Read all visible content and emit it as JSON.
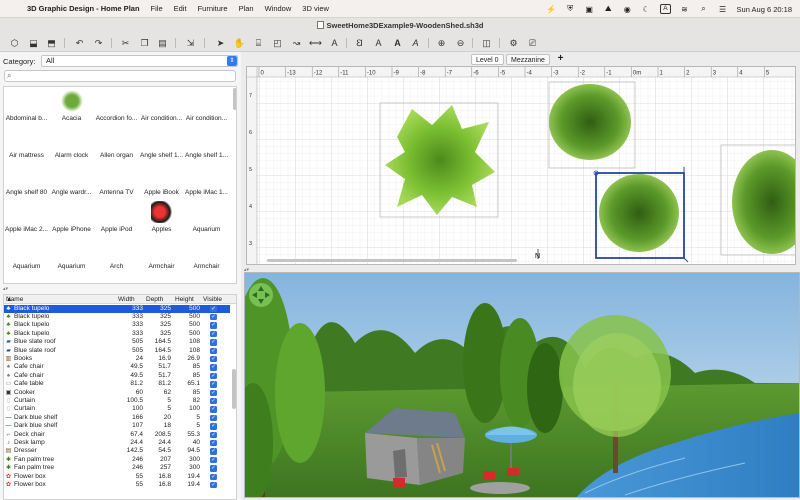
{
  "menubar": {
    "app_name": "3D Graphic Design - Home Plan",
    "menus": [
      "File",
      "Edit",
      "Furniture",
      "Plan",
      "Window",
      "3D view"
    ],
    "input_source": "A",
    "clock": "Sun Aug 6  20:18"
  },
  "window": {
    "title": "SweetHome3DExample9-WoodenShed.sh3d"
  },
  "category": {
    "label": "Category:",
    "selected": "All"
  },
  "search": {
    "placeholder": ""
  },
  "catalog": [
    {
      "label": "Abdominal b...",
      "icon": "abdominal-bench"
    },
    {
      "label": "Acacia",
      "icon": "acacia-tree"
    },
    {
      "label": "Accordion fo...",
      "icon": "accordion-door"
    },
    {
      "label": "Air condition...",
      "icon": "air-conditioner"
    },
    {
      "label": "Air condition...",
      "icon": "air-conditioner-wall"
    },
    {
      "label": "Air mattress",
      "icon": "air-mattress"
    },
    {
      "label": "Alarm clock",
      "icon": "alarm-clock"
    },
    {
      "label": "Allen organ",
      "icon": "organ"
    },
    {
      "label": "Angle shelf 1...",
      "icon": "angle-shelf"
    },
    {
      "label": "Angle shelf 1...",
      "icon": "angle-shelf"
    },
    {
      "label": "Angle shelf 80",
      "icon": "angle-shelf"
    },
    {
      "label": "Angle wardr...",
      "icon": "angle-wardrobe"
    },
    {
      "label": "Antenna TV",
      "icon": "antenna"
    },
    {
      "label": "Apple iBook",
      "icon": "laptop"
    },
    {
      "label": "Apple iMac 1...",
      "icon": "imac"
    },
    {
      "label": "Apple iMac 2...",
      "icon": "imac"
    },
    {
      "label": "Apple iPhone",
      "icon": "phone"
    },
    {
      "label": "Apple iPod",
      "icon": "ipod"
    },
    {
      "label": "Apples",
      "icon": "apples"
    },
    {
      "label": "Aquarium",
      "icon": "aquarium"
    },
    {
      "label": "Aquarium",
      "icon": "aquarium-stand"
    },
    {
      "label": "Aquarium",
      "icon": "aquarium-cabinet"
    },
    {
      "label": "Arch",
      "icon": "arch"
    },
    {
      "label": "Armchair",
      "icon": "armchair-red"
    },
    {
      "label": "Armchair",
      "icon": "armchair-black"
    }
  ],
  "furniture_table": {
    "headers": {
      "name": "Name",
      "width": "Width",
      "depth": "Depth",
      "height": "Height",
      "visible": "Visible"
    },
    "sort_indicator": "▲",
    "rows": [
      {
        "name": "Black tupelo",
        "width": "333",
        "depth": "325",
        "height": "500",
        "icon": "tree",
        "selected": true
      },
      {
        "name": "Black tupelo",
        "width": "333",
        "depth": "325",
        "height": "500",
        "icon": "tree"
      },
      {
        "name": "Black tupelo",
        "width": "333",
        "depth": "325",
        "height": "500",
        "icon": "tree"
      },
      {
        "name": "Black tupelo",
        "width": "333",
        "depth": "325",
        "height": "500",
        "icon": "tree"
      },
      {
        "name": "Blue slate roof",
        "width": "505",
        "depth": "164.5",
        "height": "108",
        "icon": "roof"
      },
      {
        "name": "Blue slate roof",
        "width": "505",
        "depth": "164.5",
        "height": "108",
        "icon": "roof"
      },
      {
        "name": "Books",
        "width": "24",
        "depth": "16.9",
        "height": "26.9",
        "icon": "books"
      },
      {
        "name": "Cafe chair",
        "width": "49.5",
        "depth": "51.7",
        "height": "85",
        "icon": "chair"
      },
      {
        "name": "Cafe chair",
        "width": "49.5",
        "depth": "51.7",
        "height": "85",
        "icon": "chair"
      },
      {
        "name": "Cafe table",
        "width": "81.2",
        "depth": "81.2",
        "height": "65.1",
        "icon": "table"
      },
      {
        "name": "Cooker",
        "width": "60",
        "depth": "62",
        "height": "85",
        "icon": "cooker"
      },
      {
        "name": "Curtain",
        "width": "100.5",
        "depth": "5",
        "height": "82",
        "icon": "curtain"
      },
      {
        "name": "Curtain",
        "width": "100",
        "depth": "5",
        "height": "100",
        "icon": "curtain"
      },
      {
        "name": "Dark blue shelf",
        "width": "166",
        "depth": "20",
        "height": "5",
        "icon": "shelf"
      },
      {
        "name": "Dark blue shelf",
        "width": "107",
        "depth": "18",
        "height": "5",
        "icon": "shelf"
      },
      {
        "name": "Deck chair",
        "width": "67.4",
        "depth": "208.5",
        "height": "55.3",
        "icon": "deck-chair"
      },
      {
        "name": "Desk lamp",
        "width": "24.4",
        "depth": "24.4",
        "height": "40",
        "icon": "lamp"
      },
      {
        "name": "Dresser",
        "width": "142.5",
        "depth": "54.5",
        "height": "94.5",
        "icon": "dresser"
      },
      {
        "name": "Fan palm tree",
        "width": "246",
        "depth": "207",
        "height": "300",
        "icon": "palm"
      },
      {
        "name": "Fan palm tree",
        "width": "246",
        "depth": "257",
        "height": "300",
        "icon": "palm"
      },
      {
        "name": "Flower box",
        "width": "55",
        "depth": "16.8",
        "height": "19.4",
        "icon": "flower-box"
      },
      {
        "name": "Flower box",
        "width": "55",
        "depth": "16.8",
        "height": "19.4",
        "icon": "flower-box"
      }
    ]
  },
  "plan": {
    "levels": [
      "Level 0",
      "Mezzanine"
    ],
    "active_level": "Level 0",
    "add_level": "+",
    "ruler_labels": [
      "0",
      "-13",
      "-12",
      "-11",
      "-10",
      "-9",
      "-8",
      "-7",
      "-6",
      "-5",
      "-4",
      "-3",
      "-2",
      "-1",
      "0m",
      "1",
      "2",
      "3",
      "4",
      "5"
    ],
    "vertical_ruler_labels": [
      "7",
      "6",
      "5",
      "4",
      "3"
    ],
    "compass_label": "N"
  },
  "colors": {
    "accent": "#2f6fe0",
    "selection": "#1f5ad7",
    "tree_green": "#7bbf32",
    "sky": "#a9cbe8",
    "grass": "#4f8a2a",
    "water": "#3f8ccf",
    "chair_red": "#d42a2a"
  }
}
